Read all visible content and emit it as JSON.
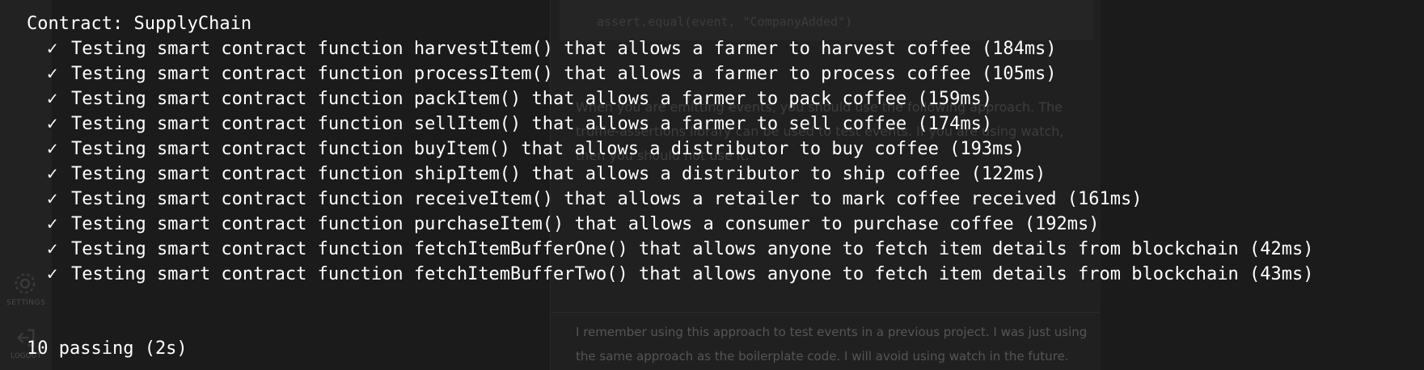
{
  "background": {
    "sidebar": {
      "settings_label": "SETTINGS",
      "logout_label": "LOGOUT"
    },
    "code_line": "assert.equal(event, \"CompanyAdded\")",
    "answer_text": "When you are emitting events, you should use the following approach. The truffle-assertions library can be used to test events. If you are using watch, then you should not use it.",
    "followup_text": "I remember using this approach to test events in a previous project. I was just using the same approach as the boilerplate code. I will avoid using watch in the future."
  },
  "terminal": {
    "contract_title": "Contract: SupplyChain",
    "check_mark": "✓",
    "tests": [
      {
        "text": "Testing smart contract function harvestItem() that allows a farmer to harvest coffee (184ms)"
      },
      {
        "text": "Testing smart contract function processItem() that allows a farmer to process coffee (105ms)"
      },
      {
        "text": "Testing smart contract function packItem() that allows a farmer to pack coffee (159ms)"
      },
      {
        "text": "Testing smart contract function sellItem() that allows a farmer to sell coffee (174ms)"
      },
      {
        "text": "Testing smart contract function buyItem() that allows a distributor to buy coffee (193ms)"
      },
      {
        "text": "Testing smart contract function shipItem() that allows a distributor to ship coffee (122ms)"
      },
      {
        "text": "Testing smart contract function receiveItem() that allows a retailer to mark coffee received (161ms)"
      },
      {
        "text": "Testing smart contract function purchaseItem() that allows a consumer to purchase coffee (192ms)"
      },
      {
        "text": "Testing smart contract function fetchItemBufferOne() that allows anyone to fetch item details from blockchain (42ms)"
      },
      {
        "text": "Testing smart contract function fetchItemBufferTwo() that allows anyone to fetch item details from blockchain (43ms)"
      }
    ],
    "summary": "10 passing (2s)"
  },
  "colors": {
    "background": "#1b1b1b",
    "text": "#ffffff"
  }
}
